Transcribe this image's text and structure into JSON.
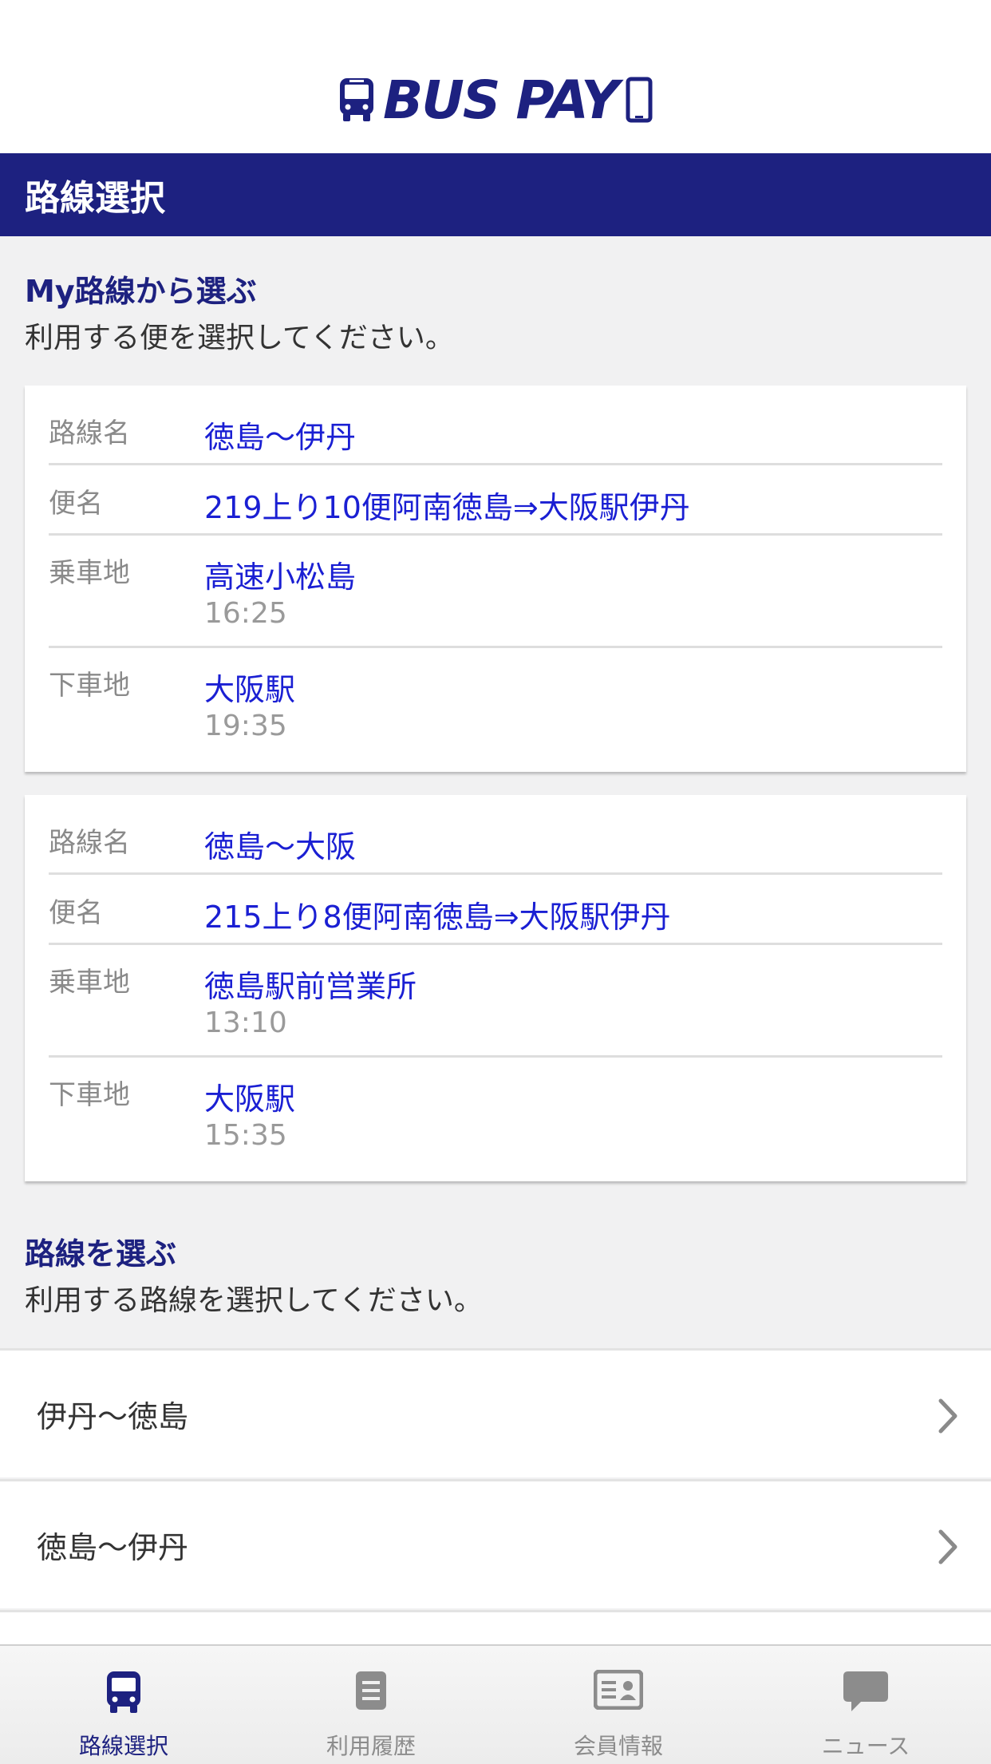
{
  "header": {
    "logo_text": "BUS PAY",
    "brand_color": "#1d2180"
  },
  "page_title": "路線選択",
  "my_routes": {
    "title": "My路線から選ぶ",
    "description": "利用する便を選択してください。",
    "cards": [
      {
        "route_label": "路線名",
        "route": "徳島〜伊丹",
        "trip_label": "便名",
        "trip": "219上り10便阿南徳島⇒大阪駅伊丹",
        "board_label": "乗車地",
        "board": "高速小松島",
        "board_time": "16:25",
        "alight_label": "下車地",
        "alight": "大阪駅",
        "alight_time": "19:35"
      },
      {
        "route_label": "路線名",
        "route": "徳島〜大阪",
        "trip_label": "便名",
        "trip": "215上り8便阿南徳島⇒大阪駅伊丹",
        "board_label": "乗車地",
        "board": "徳島駅前営業所",
        "board_time": "13:10",
        "alight_label": "下車地",
        "alight": "大阪駅",
        "alight_time": "15:35"
      }
    ]
  },
  "routes": {
    "title": "路線を選ぶ",
    "description": "利用する路線を選択してください。",
    "items": [
      "伊丹〜徳島",
      "徳島〜伊丹"
    ]
  },
  "tabbar": {
    "tabs": [
      {
        "label": "路線選択",
        "icon": "bus-icon",
        "active": true
      },
      {
        "label": "利用履歴",
        "icon": "document-icon",
        "active": false
      },
      {
        "label": "会員情報",
        "icon": "id-card-icon",
        "active": false
      },
      {
        "label": "ニュース",
        "icon": "chat-bubble-icon",
        "active": false
      }
    ]
  }
}
